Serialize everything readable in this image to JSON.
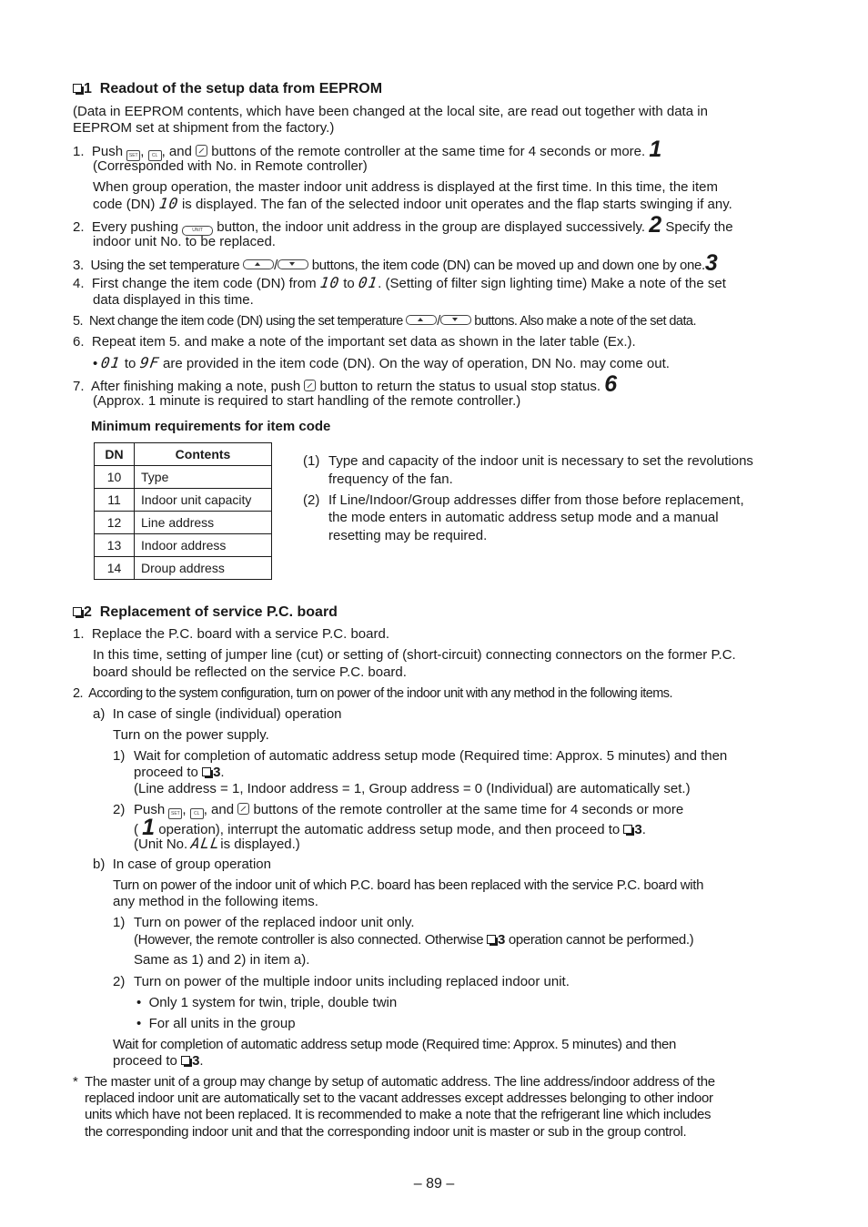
{
  "section1": {
    "number": "1",
    "title": "Readout of the setup data from EEPROM",
    "intro_line1": "(Data in EEPROM contents, which have been changed at the local site, are read out together with data in",
    "intro_line2": "EEPROM set at shipment from the factory.)",
    "steps": [
      {
        "num": "1.",
        "pre": "Push",
        "sep1": ",",
        "sep2": ", and",
        "post": "buttons of the remote controller at the same time for 4 seconds or more.",
        "step_marker": "1",
        "line2": "(Corresponded with No. in Remote controller)",
        "para_line1": "When group operation, the master indoor unit address is displayed at the first time. In this time, the item",
        "para_line2_pre": "code (DN)",
        "para_line2_code": "10",
        "para_line2_post": "is displayed. The fan of the selected indoor unit operates and the flap starts swinging if any."
      },
      {
        "num": "2.",
        "pre": "Every pushing",
        "post": "button, the indoor unit address in the group are displayed successively.",
        "step_marker": "2",
        "post2": "Specify the",
        "line2": "indoor unit No. to be replaced."
      },
      {
        "num": "3.",
        "pre": "Using the set temperature",
        "slash": "/",
        "post": "buttons, the item code (DN) can be moved up and down one by one.",
        "step_marker": "3"
      },
      {
        "num": "4.",
        "pre": "First change the item code (DN) from",
        "code1": "10",
        "mid": "to",
        "code2": "01",
        "post": ". (Setting of filter sign lighting time) Make a note of the set",
        "line2": "data displayed in this time."
      },
      {
        "num": "5.",
        "pre": "Next change the item code (DN) using the set temperature",
        "slash": "/",
        "post": "buttons. Also make a note of the set data."
      },
      {
        "num": "6.",
        "text": "Repeat item 5. and make a note of the important set data as shown in the later table (Ex.).",
        "bullet": "•",
        "b_code1": "01",
        "b_mid": "to",
        "b_code2": "9F",
        "b_post": "are provided in the item code (DN). On the way of operation, DN No. may come out."
      },
      {
        "num": "7.",
        "pre": "After finishing making a note, push",
        "post": "button to return the status to usual stop status.",
        "step_marker": "6",
        "line2": "(Approx. 1 minute is required to start handling of the remote controller.)"
      }
    ],
    "buttons": {
      "set": "SET",
      "cl": "CL",
      "unit": "UNIT"
    },
    "min_req_title": "Minimum requirements for item code",
    "table": {
      "headers": [
        "DN",
        "Contents"
      ],
      "rows": [
        [
          "10",
          "Type"
        ],
        [
          "11",
          "Indoor unit capacity"
        ],
        [
          "12",
          "Line address"
        ],
        [
          "13",
          "Indoor address"
        ],
        [
          "14",
          "Droup address"
        ]
      ]
    },
    "notes": [
      {
        "num": "(1)",
        "line1": "Type and capacity of the indoor unit is necessary to set the revolutions",
        "line2": "frequency of the fan."
      },
      {
        "num": "(2)",
        "line1": "If Line/Indoor/Group addresses differ from those before replacement,",
        "line2": "the mode enters in automatic address setup mode and a manual",
        "line3": "resetting may be required."
      }
    ]
  },
  "section2": {
    "number": "2",
    "title": "Replacement of service P.C. board",
    "step1": {
      "num": "1.",
      "text": "Replace the P.C. board with a service P.C. board.",
      "para1": "In this time, setting of jumper line (cut) or setting of (short-circuit) connecting connectors on the former P.C.",
      "para2": "board should be reflected on the service P.C. board."
    },
    "step2": {
      "num": "2.",
      "text": "According to the system configuration, turn on power of the indoor unit with any method in the following items."
    },
    "case_a": {
      "label": "a)",
      "title": "In case of single (individual) operation",
      "sub": "Turn on the power supply.",
      "item1": {
        "num": "1)",
        "line1": "Wait for completion of automatic address setup mode (Required time: Approx. 5 minutes) and then",
        "line2_pre": "proceed to",
        "ref": "3",
        "line2_post": ".",
        "line3": "(Line address = 1, Indoor address = 1, Group address = 0 (Individual) are automatically set.)"
      },
      "item2": {
        "num": "2)",
        "pre": "Push",
        "sep1": ",",
        "sep2": ", and",
        "post": "buttons of the remote controller at the same time for 4 seconds or more",
        "line2_open": "(",
        "step_marker": "1",
        "line2_post": "operation), interrupt the automatic address setup mode, and then proceed to",
        "ref": "3",
        "line2_end": ".",
        "line3_pre": "(Unit No.",
        "code": "ALL",
        "line3_post": "is displayed.)"
      }
    },
    "case_b": {
      "label": "b)",
      "title": "In case of group operation",
      "sub1": "Turn on power of the indoor unit of which P.C. board has been replaced with the service P.C. board with",
      "sub2": "any method in the following items.",
      "item1": {
        "num": "1)",
        "line1": "Turn on power of the replaced indoor unit only.",
        "line2_pre": "(However, the remote controller is also connected. Otherwise",
        "ref": "3",
        "line2_post": "operation cannot be performed.)",
        "line3": "Same as 1) and 2) in item a)."
      },
      "item2": {
        "num": "2)",
        "line1": "Turn on power of the multiple indoor units including replaced indoor unit.",
        "bullets": [
          "Only 1 system for twin, triple, double twin",
          "For all units in the group"
        ],
        "wait1": "Wait for completion of automatic address setup mode (Required time: Approx. 5 minutes) and then",
        "wait2_pre": "proceed to",
        "ref": "3",
        "wait2_post": "."
      }
    },
    "footnote": {
      "mark": "*",
      "lines": [
        "The master unit of a group may change by setup of automatic address. The line address/indoor address of the",
        "replaced indoor unit are automatically set to the vacant addresses except addresses belonging to other indoor",
        "units which have not been replaced. It is recommended to make a note that the refrigerant line which includes",
        "the corresponding indoor unit and that the corresponding indoor unit is master or sub in the group control."
      ]
    }
  },
  "page_number": "– 89 –"
}
